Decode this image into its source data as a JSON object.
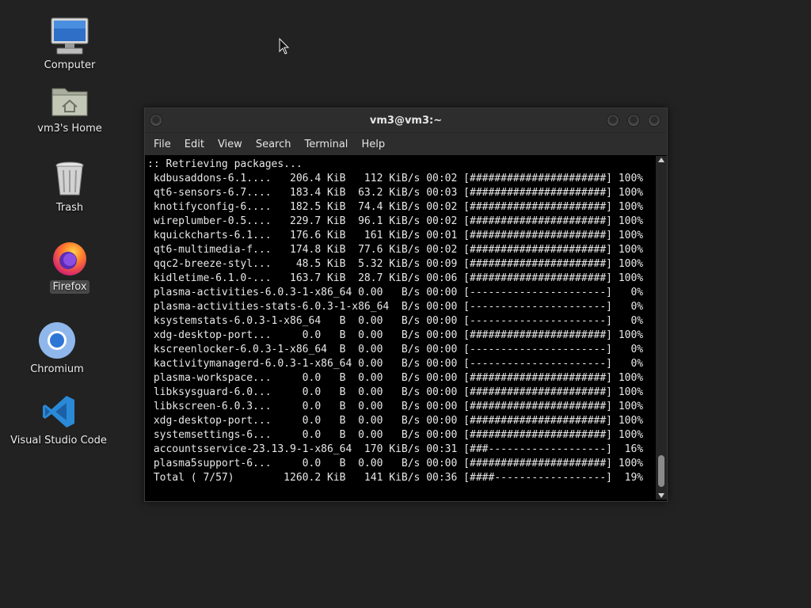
{
  "desktop": {
    "icons": [
      {
        "label": "Computer",
        "icon": "computer-icon"
      },
      {
        "label": "vm3's Home",
        "icon": "home-folder-icon"
      },
      {
        "label": "Trash",
        "icon": "trash-icon"
      },
      {
        "label": "Firefox",
        "icon": "firefox-icon"
      },
      {
        "label": "Chromium",
        "icon": "chromium-icon"
      },
      {
        "label": "Visual Studio Code",
        "icon": "vscode-icon"
      }
    ]
  },
  "window": {
    "title": "vm3@vm3:~",
    "menu": [
      "File",
      "Edit",
      "View",
      "Search",
      "Terminal",
      "Help"
    ]
  },
  "terminal": {
    "lines": [
      ":: Retrieving packages...",
      " kdbusaddons-6.1....   206.4 KiB   112 KiB/s 00:02 [######################] 100%",
      " qt6-sensors-6.7....   183.4 KiB  63.2 KiB/s 00:03 [######################] 100%",
      " knotifyconfig-6....   182.5 KiB  74.4 KiB/s 00:02 [######################] 100%",
      " wireplumber-0.5....   229.7 KiB  96.1 KiB/s 00:02 [######################] 100%",
      " kquickcharts-6.1...   176.6 KiB   161 KiB/s 00:01 [######################] 100%",
      " qt6-multimedia-f...   174.8 KiB  77.6 KiB/s 00:02 [######################] 100%",
      " qqc2-breeze-styl...    48.5 KiB  5.32 KiB/s 00:09 [######################] 100%",
      " kidletime-6.1.0-...   163.7 KiB  28.7 KiB/s 00:06 [######################] 100%",
      " plasma-activities-6.0.3-1-x86_64 0.00   B/s 00:00 [----------------------]   0%",
      " plasma-activities-stats-6.0.3-1-x86_64  B/s 00:00 [----------------------]   0%",
      " ksystemstats-6.0.3-1-x86_64   B  0.00   B/s 00:00 [----------------------]   0%",
      " xdg-desktop-port...     0.0   B  0.00   B/s 00:00 [######################] 100%",
      " kscreenlocker-6.0.3-1-x86_64  B  0.00   B/s 00:00 [----------------------]   0%",
      " kactivitymanagerd-6.0.3-1-x86_64 0.00   B/s 00:00 [----------------------]   0%",
      " plasma-workspace...     0.0   B  0.00   B/s 00:00 [######################] 100%",
      " libksysguard-6.0...     0.0   B  0.00   B/s 00:00 [######################] 100%",
      " libkscreen-6.0.3...     0.0   B  0.00   B/s 00:00 [######################] 100%",
      " xdg-desktop-port...     0.0   B  0.00   B/s 00:00 [######################] 100%",
      " systemsettings-6...     0.0   B  0.00   B/s 00:00 [######################] 100%",
      " accountsservice-23.13.9-1-x86_64  170 KiB/s 00:31 [###-------------------]  16%",
      " plasma5support-6...     0.0   B  0.00   B/s 00:00 [######################] 100%",
      " Total ( 7/57)        1260.2 KiB   141 KiB/s 00:36 [####------------------]  19%"
    ]
  }
}
